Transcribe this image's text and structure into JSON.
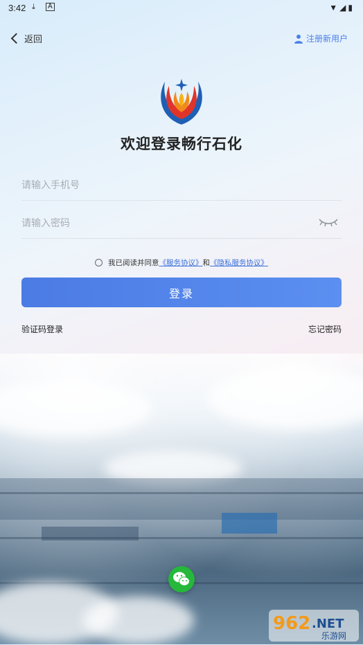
{
  "status_bar": {
    "time": "3:42"
  },
  "header": {
    "back_label": "返回",
    "register_label": "注册新用户"
  },
  "welcome_title": "欢迎登录畅行石化",
  "form": {
    "phone_placeholder": "请输入手机号",
    "password_placeholder": "请输入密码"
  },
  "agreement": {
    "prefix": "我已阅读并同意",
    "service_link": "《服务协议》",
    "conjunction": "和",
    "privacy_link": "《隐私服务协议》"
  },
  "login_button": "登录",
  "sms_login": "验证码登录",
  "forgot_password": "忘记密码",
  "watermark": {
    "number": "962",
    "suffix": ".NET",
    "sub": "乐游网"
  },
  "colors": {
    "accent": "#4b7be4",
    "link": "#3b6fd8",
    "wechat": "#25b83b"
  }
}
